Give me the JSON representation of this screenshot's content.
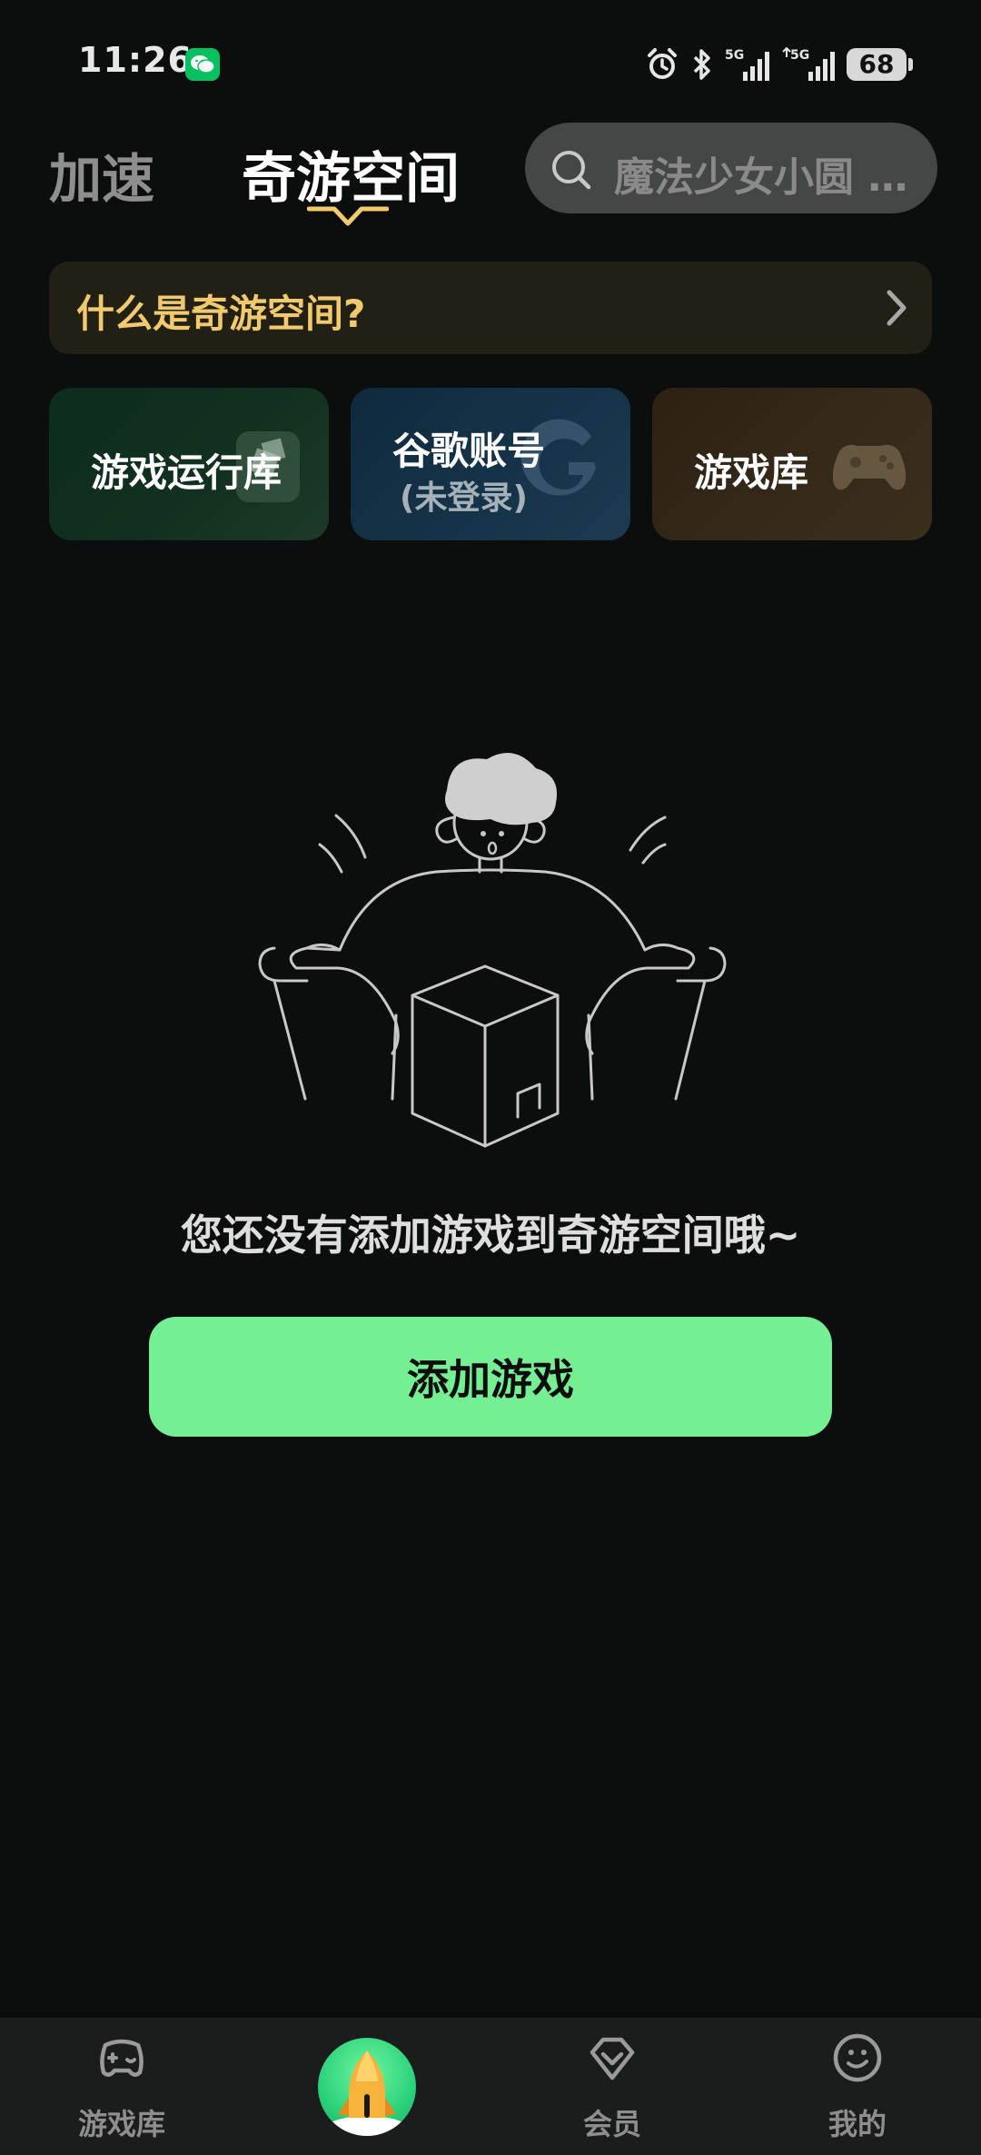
{
  "status_bar": {
    "time": "11:26",
    "battery": "68",
    "icons": [
      "wechat-icon",
      "alarm-icon",
      "bluetooth-icon",
      "signal-5g-icon",
      "signal-5g-icon"
    ]
  },
  "header": {
    "tabs": [
      {
        "label": "加速",
        "active": false
      },
      {
        "label": "奇游空间",
        "active": true
      }
    ],
    "search": {
      "placeholder": "魔法少女小圆 M..."
    }
  },
  "intro_banner": {
    "label": "什么是奇游空间?"
  },
  "cards": [
    {
      "label": "游戏运行库",
      "icon": "package-icon"
    },
    {
      "label": "谷歌账号",
      "sublabel": "(未登录)",
      "icon": "google-icon"
    },
    {
      "label": "游戏库",
      "icon": "gamepad-icon"
    }
  ],
  "empty_state": {
    "message": "您还没有添加游戏到奇游空间哦~",
    "button_label": "添加游戏"
  },
  "bottom_nav": {
    "items": [
      {
        "label": "游戏库",
        "icon": "game-controller-icon"
      },
      {
        "label": "",
        "icon": "rocket-icon"
      },
      {
        "label": "会员",
        "icon": "diamond-icon"
      },
      {
        "label": "我的",
        "icon": "smiley-icon"
      }
    ]
  },
  "colors": {
    "background": "#0c0d0d",
    "accent_green": "#76ef94",
    "banner_text": "#f1ca6e"
  }
}
